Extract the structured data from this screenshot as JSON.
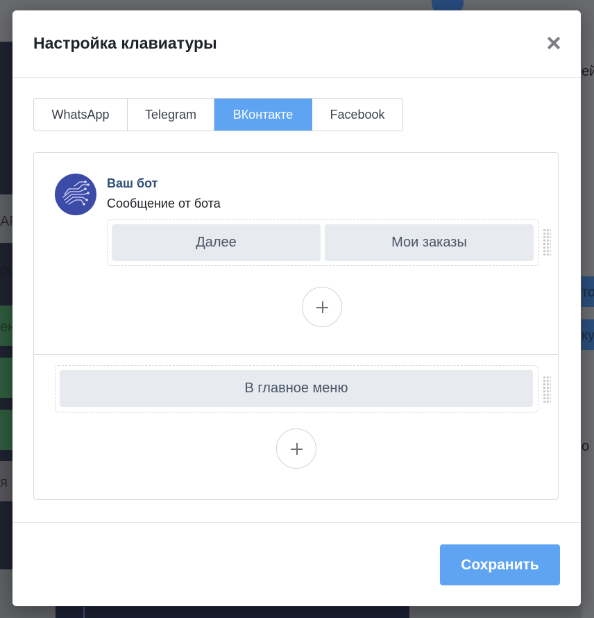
{
  "modal": {
    "title": "Настройка клавиатуры",
    "save_label": "Сохранить"
  },
  "tabs": [
    {
      "label": "WhatsApp",
      "active": false
    },
    {
      "label": "Telegram",
      "active": false
    },
    {
      "label": "ВКонтакте",
      "active": true
    },
    {
      "label": "Facebook",
      "active": false
    }
  ],
  "bot": {
    "name": "Ваш бот",
    "message": "Сообщение от бота"
  },
  "inline_keyboard": {
    "rows": [
      {
        "buttons": [
          "Далее",
          "Мои заказы"
        ]
      }
    ]
  },
  "reply_keyboard": {
    "rows": [
      {
        "buttons": [
          "В главное меню"
        ]
      }
    ]
  },
  "background": {
    "fragments": [
      "ей",
      "АР",
      "ро",
      "ен",
      "то",
      "ку",
      "я",
      "о"
    ]
  },
  "colors": {
    "accent": "#5ea4f2",
    "bot_name": "#2f4f77",
    "keyboard_button": "#e7ebef"
  }
}
